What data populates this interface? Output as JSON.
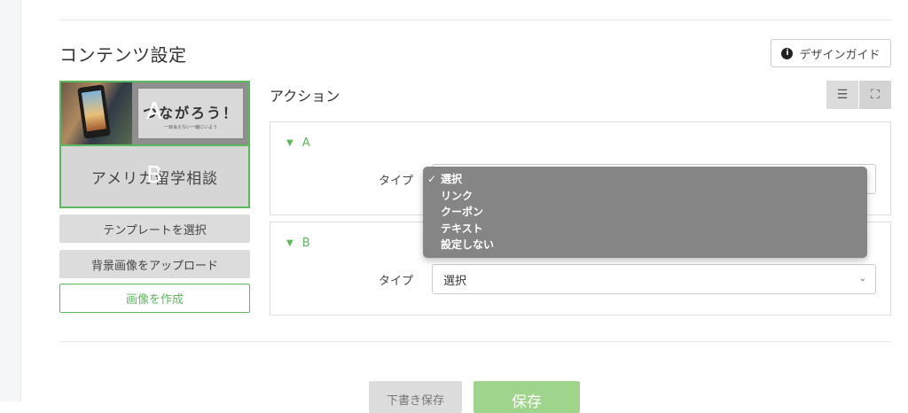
{
  "section": {
    "title": "コンテンツ設定"
  },
  "design_guide": {
    "label": "デザインガイド",
    "icon": "info-icon"
  },
  "preview": {
    "area_a_label": "A",
    "area_b_label": "B",
    "banner_text": "つながろう！",
    "banner_sub": "一目会えない一緒にいよう",
    "area_b_text": "アメリカ留学相談"
  },
  "buttons": {
    "template": "テンプレートを選択",
    "upload": "背景画像をアップロード",
    "create": "画像を作成",
    "draft": "下書き保存",
    "save": "保存"
  },
  "action": {
    "title": "アクション"
  },
  "view_toggle": {
    "list_icon": "list-icon",
    "expand_icon": "expand-icon"
  },
  "panels": [
    {
      "label": "A",
      "type_label": "タイプ",
      "value": "選択"
    },
    {
      "label": "B",
      "type_label": "タイプ",
      "value": "選択"
    }
  ],
  "dropdown": {
    "options": [
      "選択",
      "リンク",
      "クーポン",
      "テキスト",
      "設定しない"
    ],
    "selected": "選択"
  },
  "colors": {
    "accent": "#5cb85c",
    "save": "#9fd48d"
  }
}
